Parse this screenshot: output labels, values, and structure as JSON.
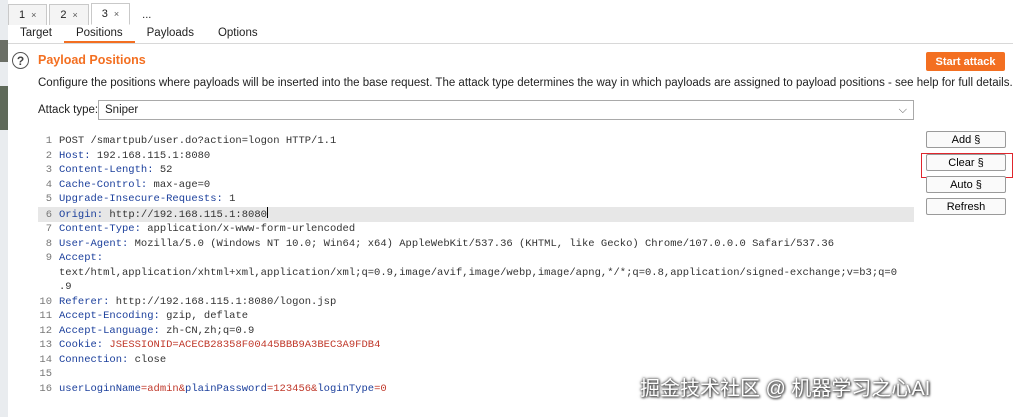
{
  "tabs": [
    {
      "label": "1",
      "close": "×"
    },
    {
      "label": "2",
      "close": "×"
    },
    {
      "label": "3",
      "close": "×"
    }
  ],
  "more_tab": "...",
  "subtabs": [
    "Target",
    "Positions",
    "Payloads",
    "Options"
  ],
  "active_subtab": "Positions",
  "help_icon": "?",
  "section_title": "Payload Positions",
  "start_attack": "Start attack",
  "description": "Configure the positions where payloads will be inserted into the base request. The attack type determines the way in which payloads are assigned to payload positions - see help for full details.",
  "attack_type": {
    "label": "Attack type:",
    "value": "Sniper",
    "chevron": "⌵"
  },
  "request": {
    "l1": {
      "n": "1",
      "text": "POST /smartpub/user.do?action=logon HTTP/1.1"
    },
    "l2": {
      "n": "2",
      "k": "Host:",
      "v": " 192.168.115.1:8080"
    },
    "l3": {
      "n": "3",
      "k": "Content-Length:",
      "v": " 52"
    },
    "l4": {
      "n": "4",
      "k": "Cache-Control:",
      "v": " max-age=0"
    },
    "l5": {
      "n": "5",
      "k": "Upgrade-Insecure-Requests:",
      "v": " 1"
    },
    "l6": {
      "n": "6",
      "k": "Origin:",
      "v": " http://192.168.115.1:8080"
    },
    "l7": {
      "n": "7",
      "k": "Content-Type:",
      "v": " application/x-www-form-urlencoded"
    },
    "l8": {
      "n": "8",
      "k": "User-Agent:",
      "v": " Mozilla/5.0 (Windows NT 10.0; Win64; x64) AppleWebKit/537.36 (KHTML, like Gecko) Chrome/107.0.0.0 Safari/537.36"
    },
    "l9": {
      "n": "9",
      "k": "Accept:",
      "c1": "text/html,application/xhtml+xml,application/xml;q=0.9,image/avif,image/webp,image/apng,*/*;q=0.8,application/signed-exchange;v=b3;q=0",
      "c2": ".9"
    },
    "l10": {
      "n": "10",
      "k": "Referer:",
      "v": " http://192.168.115.1:8080/logon.jsp"
    },
    "l11": {
      "n": "11",
      "k": "Accept-Encoding:",
      "v": " gzip, deflate"
    },
    "l12": {
      "n": "12",
      "k": "Accept-Language:",
      "v": " zh-CN,zh;q=0.9"
    },
    "l13": {
      "n": "13",
      "k": "Cookie:",
      "v": " ",
      "p": "JSESSIONID=ACECB28358F00445BBB9A3BEC3A9FDB4"
    },
    "l14": {
      "n": "14",
      "k": "Connection:",
      "v": " close"
    },
    "l15": {
      "n": "15"
    },
    "l16": {
      "n": "16",
      "k1": "userLoginName",
      "v1": "=admin&",
      "k2": "plainPassword",
      "v2": "=123456&",
      "k3": "loginType",
      "v3": "=0"
    }
  },
  "side_buttons": {
    "add": "Add §",
    "clear": "Clear §",
    "auto": "Auto §",
    "refresh": "Refresh"
  },
  "watermark": "掘金技术社区 @ 机器学习之心AI",
  "colors": {
    "accent": "#f36f21",
    "highlight_box": "#e0262d"
  }
}
